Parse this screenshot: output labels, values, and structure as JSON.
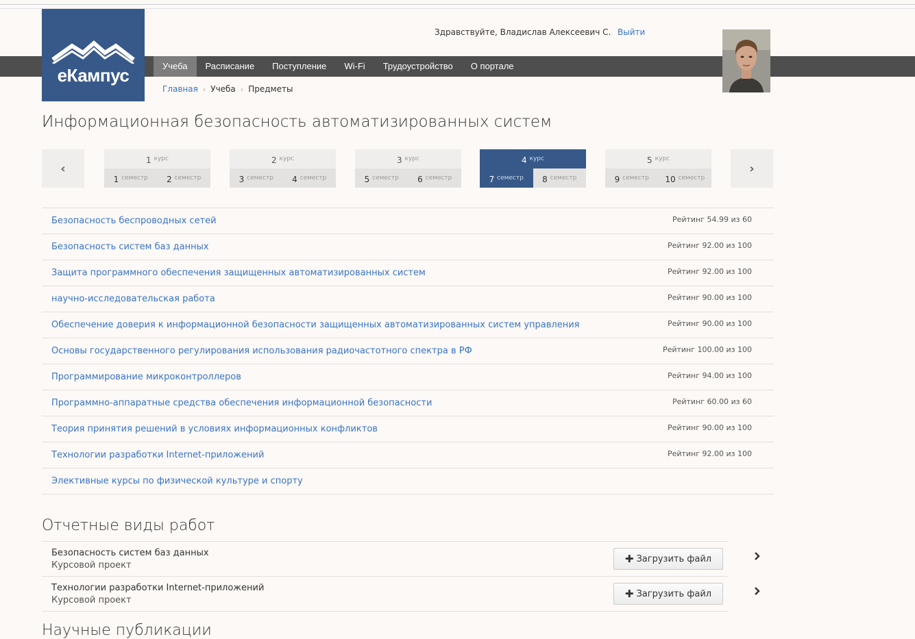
{
  "header": {
    "logo_text": "еКампус",
    "greeting": "Здравствуйте, Владислав Алексеевич С.",
    "logout": "Выйти"
  },
  "nav": {
    "items": [
      "Учеба",
      "Расписание",
      "Поступление",
      "Wi-Fi",
      "Трудоустройство",
      "О портале"
    ],
    "active_index": 0
  },
  "breadcrumb": {
    "home": "Главная",
    "study": "Учеба",
    "current": "Предметы"
  },
  "page_title": "Информационная безопасность автоматизированных систем",
  "icons": {
    "prev": "chevron-left-icon",
    "next": "chevron-right-icon",
    "upload": "plus-icon"
  },
  "course_word": "курс",
  "semester_word": "семестр",
  "courses": [
    {
      "num": "1",
      "sems": [
        "1",
        "2"
      ]
    },
    {
      "num": "2",
      "sems": [
        "3",
        "4"
      ]
    },
    {
      "num": "3",
      "sems": [
        "5",
        "6"
      ]
    },
    {
      "num": "4",
      "sems": [
        "7",
        "8"
      ],
      "active": true,
      "active_sem": "7"
    },
    {
      "num": "5",
      "sems": [
        "9",
        "10"
      ]
    }
  ],
  "subjects": [
    {
      "name": "Безопасность беспроводных сетей",
      "rating": "Рейтинг 54.99 из 60"
    },
    {
      "name": "Безопасность систем баз данных",
      "rating": "Рейтинг 92.00 из 100"
    },
    {
      "name": "Защита программного обеспечения защищенных автоматизированных систем",
      "rating": "Рейтинг 92.00 из 100"
    },
    {
      "name": "научно-исследовательская работа",
      "rating": "Рейтинг 90.00 из 100"
    },
    {
      "name": "Обеспечение доверия к информационной безопасности защищенных автоматизированных систем управления",
      "rating": "Рейтинг 90.00 из 100"
    },
    {
      "name": "Основы государственного регулирования использования радиочастотного спектра в РФ",
      "rating": "Рейтинг 100.00 из 100"
    },
    {
      "name": "Программирование микроконтроллеров",
      "rating": "Рейтинг 94.00 из 100"
    },
    {
      "name": "Программно-аппаратные средства обеспечения информационной безопасности",
      "rating": "Рейтинг 60.00 из 60"
    },
    {
      "name": "Теория принятия решений в условиях информационных конфликтов",
      "rating": "Рейтинг 90.00 из 100"
    },
    {
      "name": "Технологии разработки Internet-приложений",
      "rating": "Рейтинг 92.00 из 100"
    },
    {
      "name": "Элективные курсы по физической культуре и спорту",
      "rating": ""
    }
  ],
  "reports": {
    "title": "Отчетные виды работ",
    "upload_label": "Загрузить файл",
    "items": [
      {
        "title": "Безопасность систем баз данных",
        "type": "Курсовой проект"
      },
      {
        "title": "Технологии разработки Internet-приложений",
        "type": "Курсовой проект"
      }
    ]
  },
  "publications_title": "Научные публикации"
}
